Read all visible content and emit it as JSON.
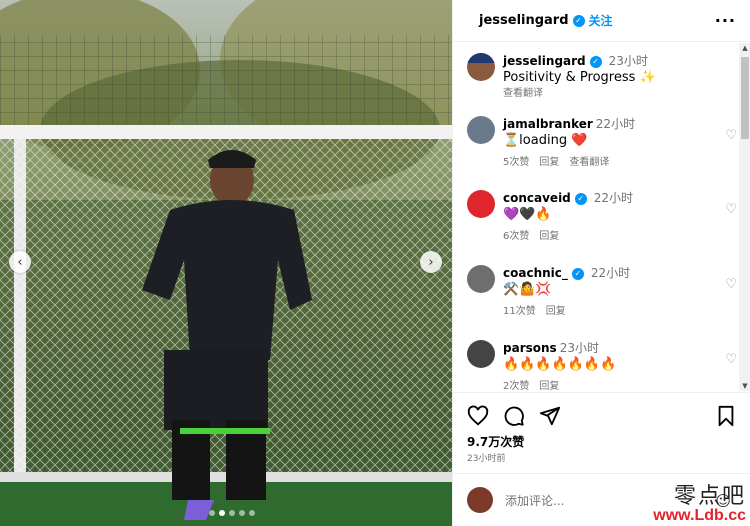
{
  "post": {
    "author": "jesselingard",
    "follow_label": "关注",
    "more_label": "···",
    "likes": "9.7万次赞",
    "posted": "23小时前",
    "add_comment_placeholder": "添加评论..."
  },
  "caption": {
    "user": "jesselingard",
    "time": "23小时",
    "text": "Positivity & Progress ✨",
    "translate": "查看翻译"
  },
  "comments": [
    {
      "user": "jamalbranker",
      "verified": false,
      "time": "22小时",
      "text": "⏳loading ❤️",
      "likes": "5次赞",
      "reply": "回复",
      "translate": "查看翻译",
      "avatar_color": "#6b7a8a"
    },
    {
      "user": "concaveid",
      "verified": true,
      "time": "22小时",
      "text": "💜🖤🔥",
      "likes": "6次赞",
      "reply": "回复",
      "avatar_color": "#e0262d"
    },
    {
      "user": "coachnic_",
      "verified": true,
      "time": "22小时",
      "text": "⚒️🤷💢",
      "likes": "11次赞",
      "reply": "回复",
      "avatar_color": "#6e6e6e"
    },
    {
      "user": "parsons",
      "verified": false,
      "time": "23小时",
      "text": "🔥🔥🔥🔥🔥🔥🔥",
      "likes": "2次赞",
      "reply": "回复",
      "avatar_color": "#444444"
    }
  ],
  "watermark": {
    "top": "零点吧",
    "bottom": "www.Ldb.cc"
  },
  "colors": {
    "accent": "#0095f6",
    "meta": "#737373",
    "watermark_red": "#e4232b"
  }
}
